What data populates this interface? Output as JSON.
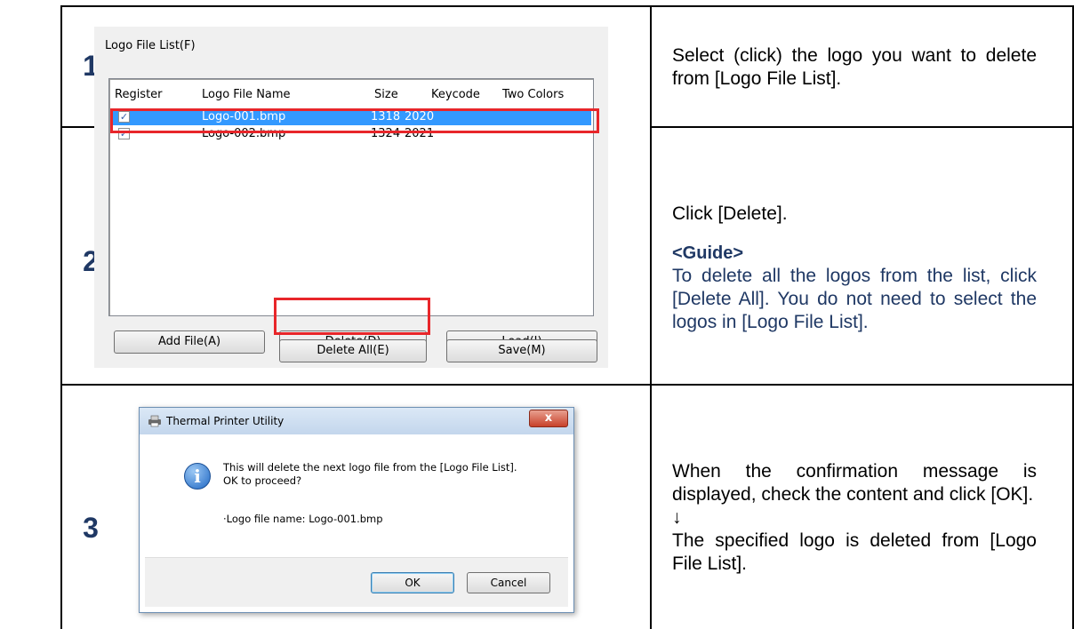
{
  "steps": [
    {
      "number": "1",
      "text": "Select (click) the logo you want to delete from [Logo File List]."
    },
    {
      "number": "2",
      "text": "Click [Delete].",
      "guide_title": "<Guide>",
      "guide_text": "To delete all the logos from the list, click [Delete All]. You do not need to select the logos in [Logo File List]."
    },
    {
      "number": "3",
      "text": "When the confirmation message is displayed, check the content and click [OK].",
      "arrow": "↓",
      "result": "The specified logo is deleted from [Logo File List]."
    }
  ],
  "logo_panel": {
    "title": "Logo File List(F)",
    "columns": [
      "Register",
      "Logo File Name",
      "Size",
      "Keycode",
      "Two Colors"
    ],
    "rows": [
      {
        "checked": "✓",
        "name": "Logo-001.bmp",
        "size": "1318",
        "keycode": "2020",
        "two_colors": ""
      },
      {
        "checked": "✓",
        "name": "Logo-002.bmp",
        "size": "1324",
        "keycode": "2021",
        "two_colors": ""
      }
    ],
    "buttons": {
      "add_file": "Add File(A)",
      "delete": "Delete(D)",
      "load": "Load(J)",
      "delete_all": "Delete All(E)",
      "save": "Save(M)"
    }
  },
  "dialog": {
    "title": "Thermal Printer Utility",
    "close": "x",
    "info_icon": "i",
    "message_line1": "This will delete the next logo file from the [Logo File List].",
    "message_line2": "OK to proceed?",
    "detail": "·Logo file name: Logo-001.bmp",
    "ok": "OK",
    "cancel": "Cancel"
  },
  "colors": {
    "step_number": "#1f3864",
    "guide": "#1f3864",
    "selection": "#3399ff",
    "highlight_box": "#e8262a"
  }
}
